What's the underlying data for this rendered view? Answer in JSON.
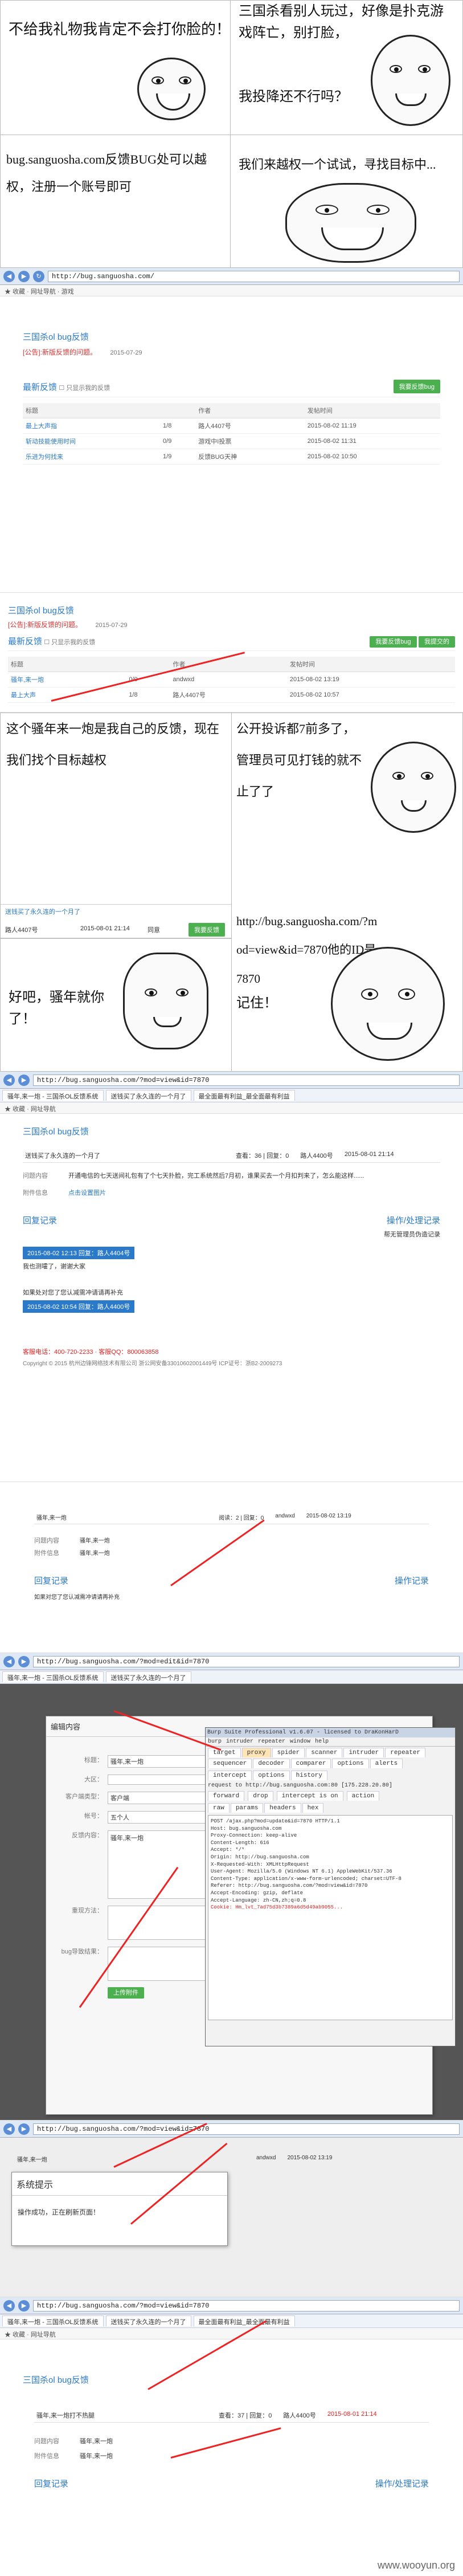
{
  "comic1": {
    "tl_text": "不给我礼物我肯定不会打你脸的！",
    "tr_text": "三国杀看别人玩过，好像是扑克游戏阵亡，别打脸，",
    "tr_text2": "我投降还不行吗？",
    "ml_text": "bug.sanguosha.com反馈BUG处可以越权，注册一个账号即可",
    "mr_text": "我们来越权一个试试，寻找目标中..."
  },
  "browser1": {
    "url": "http://bug.sanguosha.com/",
    "page_title": "三国杀ol bug反馈",
    "notice": "[公告]:新版反馈的问题。",
    "notice_date": "2015-07-29",
    "latest_label": "最新反馈",
    "only_mine": "只显示我的反馈",
    "submit_btn": "我要反馈bug",
    "columns": [
      "标题",
      "",
      "作者",
      "发帖时间"
    ],
    "rows": [
      {
        "title": "最上大声指",
        "count": "1/8",
        "author": "路人4407号",
        "time": "2015-08-02 11:19"
      },
      {
        "title": "斩动技能使用时间",
        "count": "0/9",
        "author": "游戏中I投票",
        "time": "2015-08-02 11:31"
      },
      {
        "title": "乐进为何找来",
        "count": "1/9",
        "author": "反馈BUG天神",
        "time": "2015-08-02 10:50"
      }
    ]
  },
  "browser2": {
    "page_title": "三国杀ol bug反馈",
    "notice": "[公告]:新版反馈的问题。",
    "notice_date": "2015-07-29",
    "latest_label": "最新反馈",
    "only_mine": "只显示我的反馈",
    "btn1": "我要反馈bug",
    "btn2": "我提交的",
    "columns": [
      "标题",
      "",
      "作者",
      "发帖时间"
    ],
    "rows": [
      {
        "title": "骚年,来一炮",
        "count": "0/0",
        "author": "andwxd",
        "time": "2015-08-02 13:19"
      },
      {
        "title": "最上大声",
        "count": "1/8",
        "author": "路人4407号",
        "time": "2015-08-02 10:57"
      }
    ]
  },
  "comic2": {
    "left_text": "这个骚年来一炮是我自己的反馈，现在我们找个目标越权",
    "right_text": "公开投诉都7前多了，管理员可见打钱的就不止了了",
    "row_title": "送钱买了永久连的一个月了",
    "row_author": "路人4407号",
    "row_date": "2015-08-01 21:14",
    "row_status": "同意",
    "row_btn": "我要反馈",
    "ll_text": "好吧，骚年就你了！",
    "lr_text": "http://bug.sanguosha.com/?mod=view&id=7870他的ID是7870",
    "rr_text": "记住！"
  },
  "browser3": {
    "url": "http://bug.sanguosha.com/?mod=view&id=7870",
    "tabs": [
      "骚年,来一炮 - 三国杀OL反馈系统",
      "送钱买了永久连的一个月了",
      "最全面最有利益_最全面最有利益"
    ],
    "page_title": "三国杀ol bug反馈",
    "issue_title": "送钱买了永久连的一个月了",
    "issue_meta": "查看：36 | 回复：0",
    "author": "路人4400号",
    "date": "2015-08-01 21:14",
    "q_label": "问题内容",
    "q_text": "开通电信的七天送间礼包有了个七天扑脸，完工系统然后7月初，谁果买去一个月扣判来了，怎么能这样......",
    "attach_label": "附件信息",
    "attach_text": "点击设置图片",
    "reply_head": "回复记录",
    "process_head": "操作/处理记录",
    "process_text": "帮无管理员伪造记录",
    "reply1_date": "2015-08-02 12:13 回复：路人4404号",
    "reply1_text": "我也测嚯了，谢谢大家",
    "reply2_text": "如果处对您了您认减需冲请请再补充",
    "reply2_date": "2015-08-02 10:54 回复：路人4400号",
    "footer1": "客服电话：400-720-2233 · 客服QQ：800063858",
    "footer2": "Copyright © 2015 杭州边锋网络技术有限公司 浙公网安备33010602001449号 ICP证号：浙B2-2009273"
  },
  "browser4": {
    "row_title": "骚年,来一炮",
    "row_meta": "阅读：2 | 回复：0",
    "row_author": "andwxd",
    "row_time": "2015-08-02 13:19",
    "q_label": "问题内容",
    "q_text": "骚年,来一炮",
    "a_label": "附件信息",
    "reply_label": "回复记录",
    "process_label": "操作记录",
    "bottom_text": "如果对您了您认减需冲请请再补充"
  },
  "browser5": {
    "url": "http://bug.sanguosha.com/?mod=edit&id=7870",
    "dialog_title": "编辑内容",
    "fields": [
      {
        "label": "标题：",
        "value": "骚年,来一炮"
      },
      {
        "label": "大区：",
        "value": ""
      },
      {
        "label": "客户端类型：",
        "value": "客户端"
      },
      {
        "label": "帐号：",
        "value": "五个人"
      },
      {
        "label": "反馈内容：",
        "value": "骚年,来一炮"
      },
      {
        "label": "重现方法：",
        "value": ""
      },
      {
        "label": "bug导致结果：",
        "value": ""
      }
    ],
    "submit": "上传附件",
    "burp_title": "Burp Suite Professional v1.6.07 - licensed to DraKonHarD",
    "burp_menu": [
      "burp",
      "intruder",
      "repeater",
      "window",
      "help"
    ],
    "burp_tabs": [
      "target",
      "proxy",
      "spider",
      "scanner",
      "intruder",
      "repeater",
      "sequencer",
      "decoder",
      "comparer",
      "options",
      "alerts"
    ],
    "burp_subtabs": [
      "intercept",
      "options",
      "history"
    ],
    "burp_request_line": "request to http://bug.sanguosha.com:80 [175.228.20.80]",
    "burp_buttons": [
      "forward",
      "drop",
      "intercept is on",
      "action"
    ],
    "burp_view_tabs": [
      "raw",
      "params",
      "headers",
      "hex"
    ],
    "burp_lines": [
      "POST /ajax.php?mod=update&id=7870 HTTP/1.1",
      "Host: bug.sanguosha.com",
      "Proxy-Connection: keep-alive",
      "Content-Length: 616",
      "Accept: */*",
      "Origin: http://bug.sanguosha.com",
      "X-Requested-With: XMLHttpRequest",
      "User-Agent: Mozilla/5.0 (Windows NT 6.1) AppleWebKit/537.36",
      "Content-Type: application/x-www-form-urlencoded; charset=UTF-8",
      "Referer: http://bug.sanguosha.com/?mod=view&id=7870",
      "Accept-Encoding: gzip, deflate",
      "Accept-Language: zh-CN,zh;q=0.8",
      "Cookie: Hm_lvt_7ad75d3b7389a6d5d49ab9055..."
    ]
  },
  "browser6": {
    "url": "http://bug.sanguosha.com/?mod=view&id=7870",
    "dialog_title": "系统提示",
    "dialog_text": "操作成功，正在刷新页面！",
    "row_title": "骚年,来一炮",
    "row_author": "andwxd",
    "row_time": "2015-08-02 13:19"
  },
  "browser7": {
    "url": "http://bug.sanguosha.com/?mod=view&id=7870",
    "tabs": [
      "骚年,来一炮 - 三国杀OL反馈系统",
      "送钱买了永久连的一个月了",
      "最全面最有利益_最全面最有利益"
    ],
    "page_title": "三国杀ol bug反馈",
    "issue_title": "骚年,来一炮打不热腿",
    "issue_meta": "查看：37 | 回复：0",
    "author": "路人4400号",
    "date": "2015-08-01 21:14",
    "q_label": "问题内容",
    "q_text": "骚年,来一炮",
    "a_label": "附件信息",
    "a_text": "骚年,来一炮",
    "reply_head": "回复记录",
    "process_head": "操作/处理记录"
  },
  "watermark": "www.wooyun.org"
}
